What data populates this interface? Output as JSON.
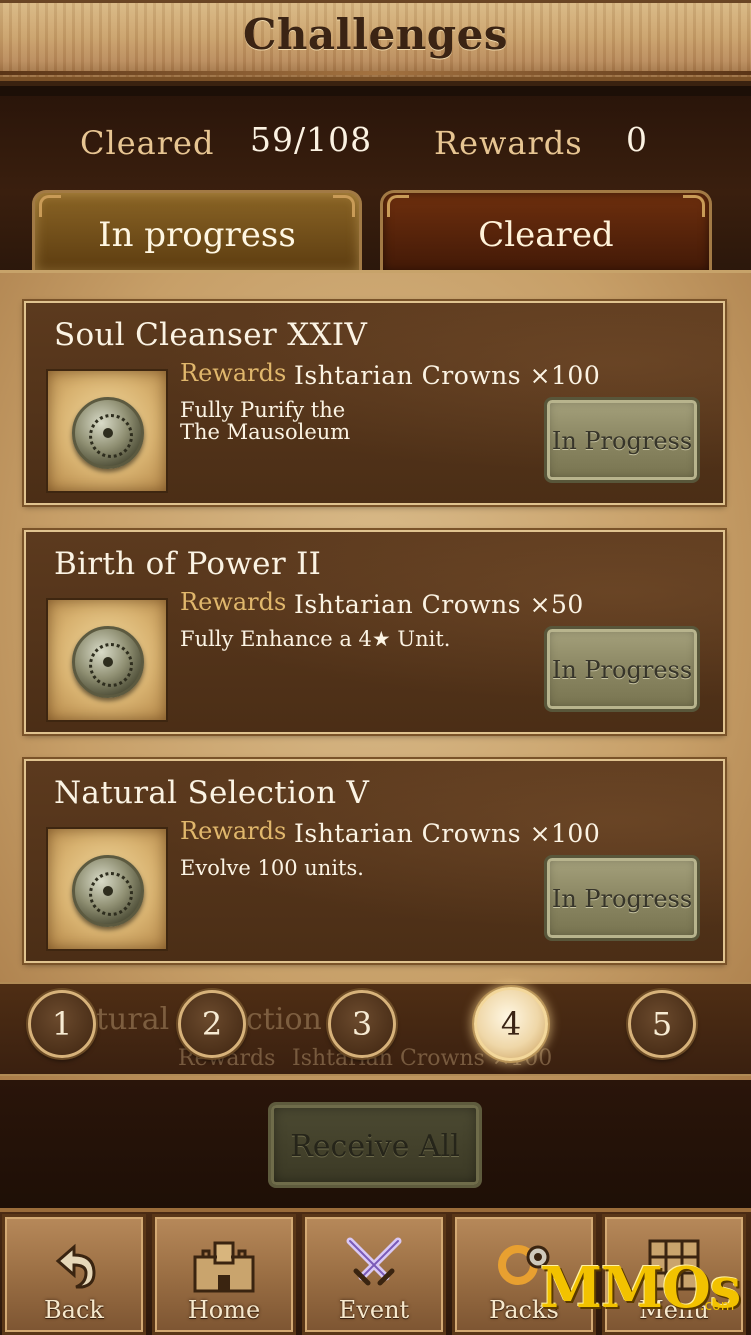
{
  "header": {
    "title": "Challenges"
  },
  "stats": {
    "cleared_label": "Cleared",
    "cleared_value": "59/108",
    "rewards_label": "Rewards",
    "rewards_value": "0"
  },
  "tabs": [
    {
      "label": "In progress",
      "active": true
    },
    {
      "label": "Cleared",
      "active": false
    }
  ],
  "challenges": [
    {
      "title": "Soul Cleanser XXIV",
      "rewards_label": "Rewards",
      "reward": "Ishtarian Crowns ×100",
      "description": "Fully Purify the\nThe Mausoleum",
      "status": "In Progress",
      "icon": "coin-icon"
    },
    {
      "title": "Birth of Power II",
      "rewards_label": "Rewards",
      "reward": "Ishtarian Crowns ×50",
      "description": "Fully Enhance a 4★ Unit.",
      "status": "In Progress",
      "icon": "coin-icon"
    },
    {
      "title": "Natural Selection V",
      "rewards_label": "Rewards",
      "reward": "Ishtarian Crowns ×100",
      "description": "Evolve 100 units.",
      "status": "In Progress",
      "icon": "coin-icon"
    }
  ],
  "pager": {
    "pages": [
      "1",
      "2",
      "3",
      "4",
      "5"
    ],
    "current": "4",
    "ghost_title_1": "tural",
    "ghost_title_2": "ction",
    "ghost_rewards_label": "Rewards",
    "ghost_reward": "Ishtarian Crowns ×100"
  },
  "receive_all": {
    "label": "Receive All",
    "enabled": false
  },
  "nav": [
    {
      "label": "Back",
      "icon": "back-arrow-icon"
    },
    {
      "label": "Home",
      "icon": "castle-icon"
    },
    {
      "label": "Event",
      "icon": "crossed-swords-icon"
    },
    {
      "label": "Packs",
      "icon": "sun-gear-icon"
    },
    {
      "label": "Menu",
      "icon": "grid-menu-icon"
    }
  ],
  "watermark": {
    "text": "MMOs",
    "suffix": ".com"
  },
  "colors": {
    "header_bg": "#c9a06a",
    "panel_bg": "#c79f68",
    "card_bg": "#4b2e16",
    "progress_button": "#8b8763",
    "accent_gold": "#e0b76c",
    "watermark": "#f2c200"
  }
}
